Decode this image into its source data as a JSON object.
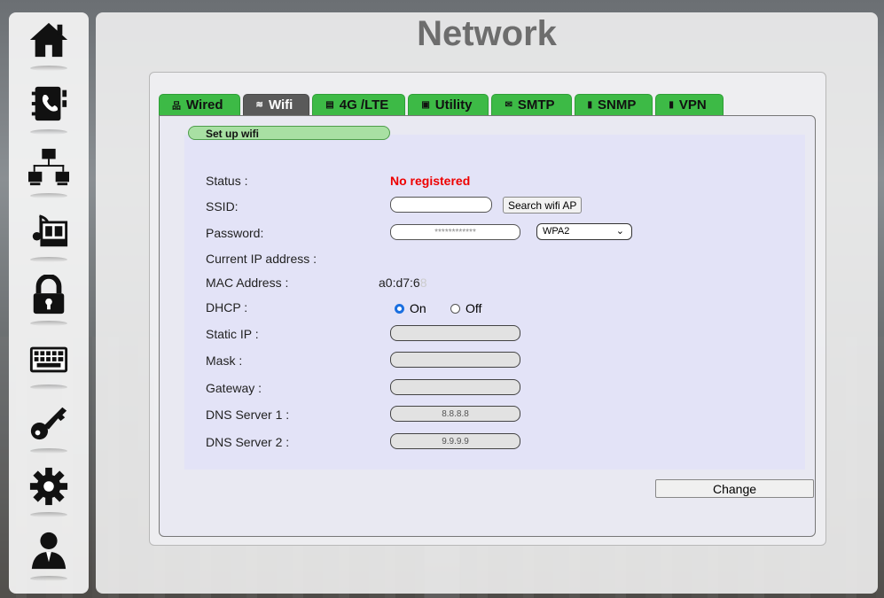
{
  "page_title": "Network",
  "sidebar": {
    "items": [
      {
        "icon": "home-icon"
      },
      {
        "icon": "contacts-book-icon"
      },
      {
        "icon": "network-icon"
      },
      {
        "icon": "media-icon"
      },
      {
        "icon": "lock-icon"
      },
      {
        "icon": "keyboard-icon"
      },
      {
        "icon": "key-icon"
      },
      {
        "icon": "gear-icon"
      },
      {
        "icon": "user-icon"
      }
    ]
  },
  "tabs": [
    {
      "label": "Wired",
      "glyph": "品",
      "active": false
    },
    {
      "label": "Wifi",
      "glyph": "≋",
      "active": true
    },
    {
      "label": "4G /LTE",
      "glyph": "▤",
      "active": false
    },
    {
      "label": "Utility",
      "glyph": "▣",
      "active": false
    },
    {
      "label": "SMTP",
      "glyph": "✉",
      "active": false
    },
    {
      "label": "SNMP",
      "glyph": "▮",
      "active": false
    },
    {
      "label": "VPN",
      "glyph": "▮",
      "active": false
    }
  ],
  "section_title": "Set up wifi",
  "fields": {
    "status_label": "Status :",
    "status_value": "No registered",
    "ssid_label": "SSID:",
    "ssid_value": "",
    "search_button": "Search wifi AP",
    "password_label": "Password:",
    "password_value": "************",
    "security_selected": "WPA2",
    "current_ip_label": "Current IP address :",
    "mac_label": "MAC Address :",
    "mac_value": "a0:d7:6",
    "mac_value_faded": "8",
    "dhcp_label": "DHCP :",
    "dhcp_on": "On",
    "dhcp_off": "Off",
    "static_ip_label": "Static IP :",
    "mask_label": "Mask :",
    "gateway_label": "Gateway :",
    "dns1_label": "DNS Server 1 :",
    "dns1_value": "8.8.8.8",
    "dns2_label": "DNS Server 2 :",
    "dns2_value": "9.9.9.9"
  },
  "change_button": "Change"
}
